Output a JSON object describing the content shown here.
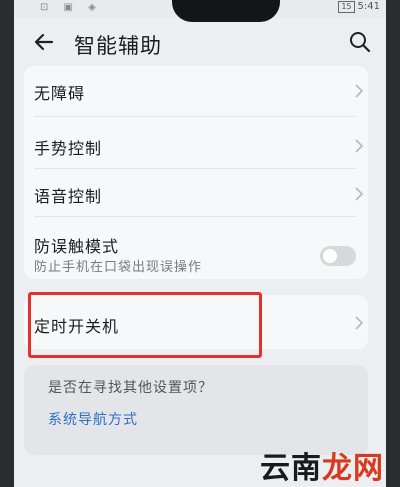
{
  "status_bar": {
    "left_icons": "⊡ ▣ ◈",
    "battery": "15",
    "time": "5:41"
  },
  "header": {
    "title": "智能辅助"
  },
  "settings_items": [
    {
      "label": "无障碍"
    },
    {
      "label": "手势控制"
    },
    {
      "label": "语音控制"
    },
    {
      "label": "防误触模式",
      "subtitle": "防止手机在口袋出现误操作",
      "toggle_on": false
    }
  ],
  "highlighted_item": {
    "label": "定时开关机"
  },
  "suggestion": {
    "question": "是否在寻找其他设置项？",
    "link": "系统导航方式"
  },
  "watermark": {
    "text_main": "云南",
    "text_accent": "龙网"
  },
  "colors": {
    "highlight_border": "#e8302a",
    "link": "#2d6fc7"
  }
}
